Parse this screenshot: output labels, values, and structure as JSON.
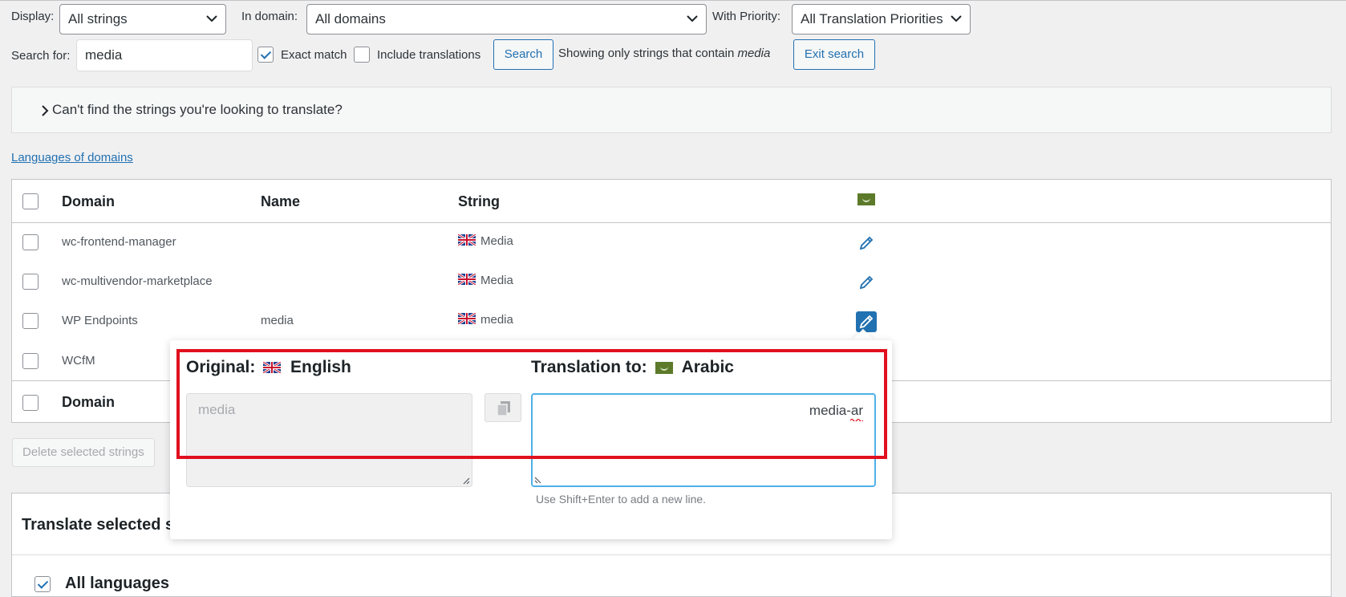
{
  "filters": {
    "display_label": "Display:",
    "display_value": "All strings",
    "domain_label": "In domain:",
    "domain_value": "All domains",
    "priority_label": "With Priority:",
    "priority_value": "All Translation Priorities"
  },
  "search": {
    "label": "Search for:",
    "value": "media",
    "exact_match_label": "Exact match",
    "exact_match_checked": true,
    "include_translations_label": "Include translations",
    "include_translations_checked": false,
    "search_button": "Search",
    "showing_text": "Showing only strings that contain",
    "showing_term": "media",
    "exit_button": "Exit search"
  },
  "notice": {
    "text": "Can't find the strings you're looking to translate?"
  },
  "languages_link": "Languages of domains",
  "table": {
    "headers": {
      "domain": "Domain",
      "name": "Name",
      "string": "String"
    },
    "rows": [
      {
        "domain": "wc-frontend-manager",
        "name": "",
        "string": "Media"
      },
      {
        "domain": "wc-multivendor-marketplace",
        "name": "",
        "string": "Media"
      },
      {
        "domain": "WP Endpoints",
        "name": "media",
        "string": "media"
      },
      {
        "domain": "WCfM",
        "name": "",
        "string": ""
      }
    ],
    "footer_domain": "Domain"
  },
  "delete_button": "Delete selected strings",
  "translate_panel": {
    "title": "Translate selected s",
    "all_languages": "All languages"
  },
  "popup": {
    "original_label": "Original:",
    "original_language": "English",
    "translation_label": "Translation to:",
    "translation_language": "Arabic",
    "original_text": "media",
    "translation_text": "media-ar",
    "hint": "Use Shift+Enter to add a new line."
  },
  "colors": {
    "accent": "#2271b1",
    "highlight_border": "#e0101f",
    "arabic_flag": "#5c7a2a"
  }
}
